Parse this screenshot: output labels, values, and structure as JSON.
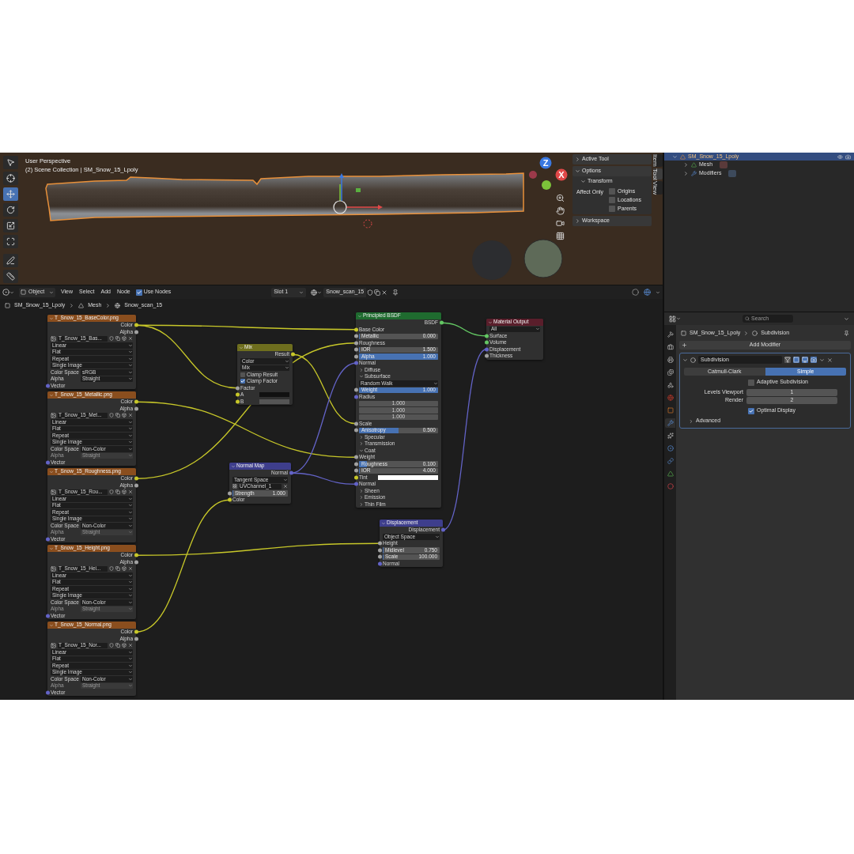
{
  "viewport": {
    "title": "User Perspective",
    "collection": "(2) Scene Collection | SM_Snow_15_Lpoly",
    "tools": [
      {
        "selected": false
      },
      {
        "selected": false
      },
      {
        "selected": true
      },
      {
        "selected": false
      },
      {
        "selected": false
      },
      {
        "selected": false
      },
      {
        "selected": false
      },
      {
        "selected": false
      }
    ],
    "axis_labels": [
      "Z",
      "X"
    ],
    "sidebar": {
      "panels": [
        {
          "title": "Active Tool",
          "expanded": false
        },
        {
          "title": "Options",
          "expanded": true,
          "subpanel": {
            "title": "Transform",
            "expanded": true
          },
          "affect_label": "Affect Only",
          "options": [
            {
              "label": "Origins",
              "checked": false
            },
            {
              "label": "Locations",
              "checked": false
            },
            {
              "label": "Parents",
              "checked": false
            }
          ]
        },
        {
          "title": "Workspace",
          "expanded": false
        }
      ]
    },
    "tabs": [
      {
        "label": "Item",
        "selected": false
      },
      {
        "label": "Tool",
        "selected": true
      },
      {
        "label": "View",
        "selected": false
      }
    ]
  },
  "outliner": {
    "items": [
      {
        "label": "SM_Snow_15_Lpoly",
        "selected": true,
        "expanded": true,
        "children": [
          {
            "label": "Mesh",
            "expanded": false
          },
          {
            "label": "Modifiers",
            "expanded": false
          }
        ]
      }
    ]
  },
  "node_editor": {
    "mode": "Object",
    "menus": [
      "View",
      "Select",
      "Add",
      "Node"
    ],
    "use_nodes": {
      "label": "Use Nodes",
      "checked": true
    },
    "slot": "Slot 1",
    "material": "Snow_scan_15",
    "breadcrumb": [
      "SM_Snow_15_Lpoly",
      "Mesh",
      "Snow_scan_15"
    ],
    "nodes": [
      {
        "kind": "image",
        "title": "T_Snow_15_BaseColor.png",
        "rows": [
          {
            "kind": "output",
            "label": "Color",
            "socket": {
              "color": "#c7c729"
            }
          },
          {
            "kind": "output",
            "label": "Alpha",
            "socket": {
              "color": "#a1a1a1"
            }
          },
          {
            "kind": "image",
            "value": "T_Snow_15_Bas..."
          },
          {
            "kind": "dropdown",
            "value": "Linear"
          },
          {
            "kind": "dropdown",
            "value": "Flat"
          },
          {
            "kind": "dropdown",
            "value": "Repeat"
          },
          {
            "kind": "dropdown",
            "value": "Single Image"
          },
          {
            "kind": "dropdown",
            "label": "Color Space",
            "value": "sRGB"
          },
          {
            "kind": "dropdown",
            "label": "Alpha",
            "value": "Straight",
            "disabled": false
          },
          {
            "kind": "input",
            "label": "Vector",
            "socket": {
              "color": "#6363c7"
            }
          }
        ]
      },
      {
        "kind": "image",
        "title": "T_Snow_15_Metallic.png",
        "rows": [
          {
            "kind": "output",
            "label": "Color",
            "socket": {
              "color": "#c7c729"
            }
          },
          {
            "kind": "output",
            "label": "Alpha",
            "socket": {
              "color": "#a1a1a1"
            }
          },
          {
            "kind": "image",
            "value": "T_Snow_15_Met..."
          },
          {
            "kind": "dropdown",
            "value": "Linear"
          },
          {
            "kind": "dropdown",
            "value": "Flat"
          },
          {
            "kind": "dropdown",
            "value": "Repeat"
          },
          {
            "kind": "dropdown",
            "value": "Single Image"
          },
          {
            "kind": "dropdown",
            "label": "Color Space",
            "value": "Non-Color"
          },
          {
            "kind": "dropdown",
            "label": "Alpha",
            "value": "Straight",
            "disabled": true
          },
          {
            "kind": "input",
            "label": "Vector",
            "socket": {
              "color": "#6363c7"
            }
          }
        ]
      },
      {
        "kind": "image",
        "title": "T_Snow_15_Roughness.png",
        "rows": [
          {
            "kind": "output",
            "label": "Color",
            "socket": {
              "color": "#c7c729"
            }
          },
          {
            "kind": "output",
            "label": "Alpha",
            "socket": {
              "color": "#a1a1a1"
            }
          },
          {
            "kind": "image",
            "value": "T_Snow_15_Rou..."
          },
          {
            "kind": "dropdown",
            "value": "Linear"
          },
          {
            "kind": "dropdown",
            "value": "Flat"
          },
          {
            "kind": "dropdown",
            "value": "Repeat"
          },
          {
            "kind": "dropdown",
            "value": "Single Image"
          },
          {
            "kind": "dropdown",
            "label": "Color Space",
            "value": "Non-Color"
          },
          {
            "kind": "dropdown",
            "label": "Alpha",
            "value": "Straight",
            "disabled": true
          },
          {
            "kind": "input",
            "label": "Vector",
            "socket": {
              "color": "#6363c7"
            }
          }
        ]
      },
      {
        "kind": "image",
        "title": "T_Snow_15_Height.png",
        "rows": [
          {
            "kind": "output",
            "label": "Color",
            "socket": {
              "color": "#c7c729"
            }
          },
          {
            "kind": "output",
            "label": "Alpha",
            "socket": {
              "color": "#a1a1a1"
            }
          },
          {
            "kind": "image",
            "value": "T_Snow_15_Hei..."
          },
          {
            "kind": "dropdown",
            "value": "Linear"
          },
          {
            "kind": "dropdown",
            "value": "Flat"
          },
          {
            "kind": "dropdown",
            "value": "Repeat"
          },
          {
            "kind": "dropdown",
            "value": "Single Image"
          },
          {
            "kind": "dropdown",
            "label": "Color Space",
            "value": "Non-Color"
          },
          {
            "kind": "dropdown",
            "label": "Alpha",
            "value": "Straight",
            "disabled": true
          },
          {
            "kind": "input",
            "label": "Vector",
            "socket": {
              "color": "#6363c7"
            }
          }
        ]
      },
      {
        "kind": "image",
        "title": "T_Snow_15_Normal.png",
        "rows": [
          {
            "kind": "output",
            "label": "Color",
            "socket": {
              "color": "#c7c729"
            }
          },
          {
            "kind": "output",
            "label": "Alpha",
            "socket": {
              "color": "#a1a1a1"
            }
          },
          {
            "kind": "image",
            "value": "T_Snow_15_Nor..."
          },
          {
            "kind": "dropdown",
            "value": "Linear"
          },
          {
            "kind": "dropdown",
            "value": "Flat"
          },
          {
            "kind": "dropdown",
            "value": "Repeat"
          },
          {
            "kind": "dropdown",
            "value": "Single Image"
          },
          {
            "kind": "dropdown",
            "label": "Color Space",
            "value": "Non-Color"
          },
          {
            "kind": "dropdown",
            "label": "Alpha",
            "value": "Straight",
            "disabled": true
          },
          {
            "kind": "input",
            "label": "Vector",
            "socket": {
              "color": "#6363c7"
            }
          }
        ]
      },
      {
        "kind": "mix",
        "title": "Mix",
        "rows": [
          {
            "kind": "output",
            "label": "Result",
            "socket": {
              "color": "#c7c729"
            }
          },
          {
            "kind": "dropdown",
            "value": "Color"
          },
          {
            "kind": "dropdown",
            "value": "Mix"
          },
          {
            "kind": "checkbox",
            "label": "Clamp Result",
            "checked": false
          },
          {
            "kind": "checkbox",
            "label": "Clamp Factor",
            "checked": true
          },
          {
            "kind": "input",
            "label": "Factor",
            "socket": {
              "color": "#a1a1a1"
            }
          },
          {
            "kind": "color",
            "label": "A",
            "socket": {
              "color": "#c7c729"
            },
            "color": "#111111"
          },
          {
            "kind": "color",
            "label": "B",
            "socket": {
              "color": "#c7c729"
            },
            "color": "#555555"
          }
        ]
      },
      {
        "kind": "normal_map",
        "title": "Normal Map",
        "rows": [
          {
            "kind": "output",
            "label": "Normal",
            "socket": {
              "color": "#6363c7"
            }
          },
          {
            "kind": "dropdown",
            "value": "Tangent Space"
          },
          {
            "kind": "uv_map",
            "value": "UVChannel_1"
          },
          {
            "kind": "slider",
            "label": "Strength",
            "value": "1.000",
            "level": 0,
            "socket": {
              "color": "#a1a1a1"
            }
          },
          {
            "kind": "input",
            "label": "Color",
            "socket": {
              "color": "#c7c729"
            }
          }
        ]
      },
      {
        "kind": "bsdf",
        "title": "Principled BSDF",
        "rows": [
          {
            "kind": "output",
            "label": "BSDF",
            "socket": {
              "color": "#63c763"
            }
          },
          {
            "kind": "input",
            "label": "Base Color",
            "socket": {
              "color": "#c7c729"
            }
          },
          {
            "kind": "slider",
            "label": "Metallic",
            "value": "0.000",
            "level": 0,
            "socket": {
              "color": "#a1a1a1"
            }
          },
          {
            "kind": "input",
            "label": "Roughness",
            "socket": {
              "color": "#a1a1a1"
            }
          },
          {
            "kind": "slider",
            "label": "IOR",
            "value": "1.500",
            "level": 0,
            "socket": {
              "color": "#a1a1a1"
            }
          },
          {
            "kind": "slider",
            "label": "Alpha",
            "value": "1.000",
            "level": 1,
            "socket": {
              "color": "#a1a1a1"
            }
          },
          {
            "kind": "input",
            "label": "Normal",
            "socket": {
              "color": "#6363c7"
            }
          },
          {
            "kind": "panel",
            "label": "Diffuse",
            "expanded": false
          },
          {
            "kind": "panel",
            "label": "Subsurface",
            "expanded": true
          },
          {
            "kind": "dropdown",
            "value": "Random Walk"
          },
          {
            "kind": "slider",
            "label": "Weight",
            "value": "1.000",
            "level": 1,
            "socket": {
              "color": "#a1a1a1"
            }
          },
          {
            "kind": "input",
            "label": "Radius",
            "socket": {
              "color": "#6363c7"
            }
          },
          {
            "kind": "field",
            "value": "1.000"
          },
          {
            "kind": "field",
            "value": "1.000"
          },
          {
            "kind": "field",
            "value": "1.000"
          },
          {
            "kind": "input",
            "label": "Scale",
            "socket": {
              "color": "#a1a1a1"
            }
          },
          {
            "kind": "slider",
            "label": "Anisotropy",
            "value": "0.500",
            "level": 0.5,
            "socket": {
              "color": "#a1a1a1"
            }
          },
          {
            "kind": "panel",
            "label": "Specular",
            "expanded": false
          },
          {
            "kind": "panel",
            "label": "Transmission",
            "expanded": false
          },
          {
            "kind": "panel",
            "label": "Coat",
            "expanded": true
          },
          {
            "kind": "input",
            "label": "Weight",
            "socket": {
              "color": "#a1a1a1"
            }
          },
          {
            "kind": "slider",
            "label": "Roughness",
            "value": "0.100",
            "level": 0.1,
            "socket": {
              "color": "#a1a1a1"
            }
          },
          {
            "kind": "slider",
            "label": "IOR",
            "value": "4.000",
            "level": 0,
            "socket": {
              "color": "#a1a1a1"
            }
          },
          {
            "kind": "color",
            "label": "Tint",
            "socket": {
              "color": "#c7c729"
            },
            "color": "#ffffff"
          },
          {
            "kind": "input",
            "label": "Normal",
            "socket": {
              "color": "#6363c7"
            }
          },
          {
            "kind": "panel",
            "label": "Sheen",
            "expanded": false
          },
          {
            "kind": "panel",
            "label": "Emission",
            "expanded": false
          },
          {
            "kind": "panel",
            "label": "Thin Film",
            "expanded": false
          }
        ]
      },
      {
        "kind": "output",
        "title": "Material Output",
        "rows": [
          {
            "kind": "dropdown",
            "value": "All"
          },
          {
            "kind": "input",
            "label": "Surface",
            "socket": {
              "color": "#63c763"
            }
          },
          {
            "kind": "input",
            "label": "Volume",
            "socket": {
              "color": "#63c763"
            }
          },
          {
            "kind": "input",
            "label": "Displacement",
            "socket": {
              "color": "#6363c7"
            }
          },
          {
            "kind": "input",
            "label": "Thickness",
            "socket": {
              "color": "#a1a1a1"
            }
          }
        ]
      },
      {
        "kind": "displacement",
        "title": "Displacement",
        "rows": [
          {
            "kind": "output",
            "label": "Displacement",
            "socket": {
              "color": "#6363c7"
            }
          },
          {
            "kind": "dropdown",
            "value": "Object Space"
          },
          {
            "kind": "input",
            "label": "Height",
            "socket": {
              "color": "#a1a1a1"
            }
          },
          {
            "kind": "slider",
            "label": "Midlevel",
            "value": "0.750",
            "level": 0,
            "socket": {
              "color": "#a1a1a1"
            }
          },
          {
            "kind": "slider",
            "label": "Scale",
            "value": "100.000",
            "level": 0,
            "socket": {
              "color": "#a1a1a1"
            }
          },
          {
            "kind": "input",
            "label": "Normal",
            "socket": {
              "color": "#6363c7"
            }
          }
        ]
      }
    ]
  },
  "properties": {
    "search_placeholder": "Search",
    "tabs": [
      {
        "selected": false
      },
      {
        "selected": false
      },
      {
        "selected": false
      },
      {
        "selected": false
      },
      {
        "selected": false
      },
      {
        "selected": false
      },
      {
        "selected": false
      },
      {
        "selected": true
      },
      {
        "selected": false
      },
      {
        "selected": false
      },
      {
        "selected": false
      },
      {
        "selected": false
      },
      {
        "selected": false
      }
    ],
    "breadcrumb": [
      "SM_Snow_15_Lpoly",
      "Subdivision"
    ],
    "add_modifier": "Add Modifier",
    "modifier": {
      "name": "Subdivision",
      "expanded": true,
      "methods": [
        {
          "label": "Catmull-Clark",
          "selected": false
        },
        {
          "label": "Simple",
          "selected": true
        }
      ],
      "adaptive": {
        "label": "Adaptive Subdivision",
        "checked": false
      },
      "fields": [
        {
          "label": "Levels Viewport",
          "value": "1"
        },
        {
          "label": "Render",
          "value": "2"
        }
      ],
      "optimal": {
        "label": "Optimal Display",
        "checked": true
      },
      "advanced": {
        "label": "Advanced",
        "expanded": false
      }
    }
  }
}
